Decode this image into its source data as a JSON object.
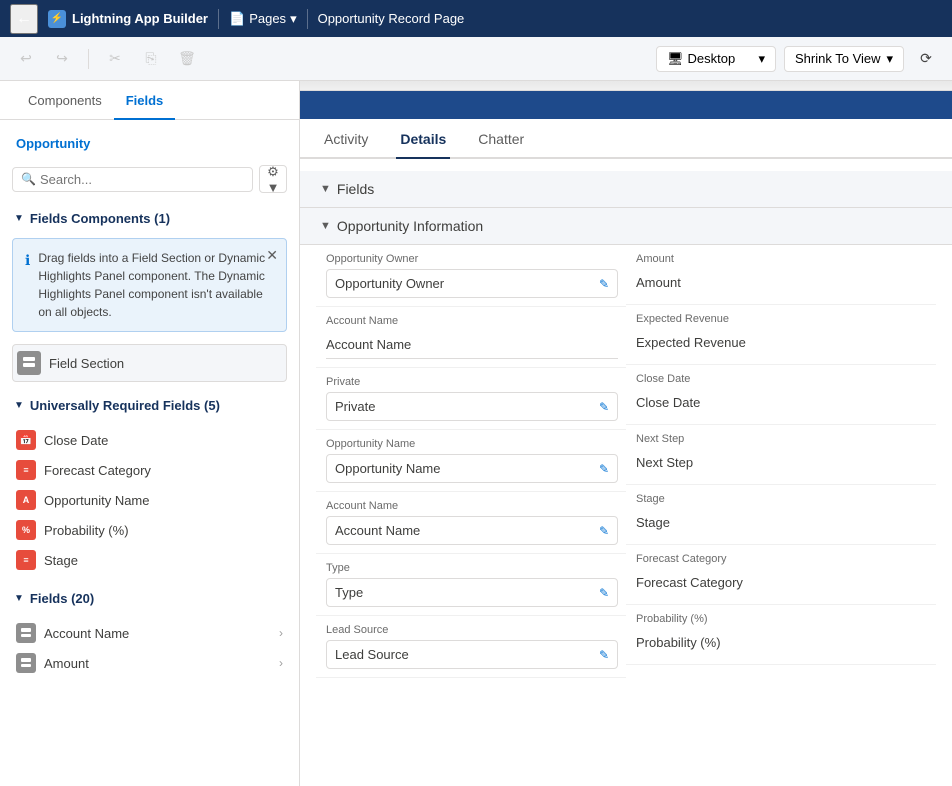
{
  "topNav": {
    "backLabel": "←",
    "appIcon": "⚡",
    "appName": "Lightning App Builder",
    "pagesLabel": "Pages",
    "pageTitle": "Opportunity Record Page"
  },
  "toolbar": {
    "undoLabel": "↩",
    "redoLabel": "↪",
    "cutLabel": "✂",
    "copyLabel": "⧉",
    "deleteLabel": "🗑",
    "desktopLabel": "Desktop",
    "shrinkLabel": "Shrink To View"
  },
  "sidebar": {
    "tab1": "Components",
    "tab2": "Fields",
    "sectionTitle": "Opportunity",
    "searchPlaceholder": "Search...",
    "fieldsComponents": {
      "header": "Fields Components (1)",
      "infoText": "Drag fields into a Field Section or Dynamic Highlights Panel component. The Dynamic Highlights Panel component isn't available on all objects.",
      "item": "Field Section"
    },
    "universallyRequired": {
      "header": "Universally Required Fields (5)",
      "items": [
        {
          "label": "Close Date",
          "type": "date"
        },
        {
          "label": "Forecast Category",
          "type": "list"
        },
        {
          "label": "Opportunity Name",
          "type": "text"
        },
        {
          "label": "Probability (%)",
          "type": "num"
        },
        {
          "label": "Stage",
          "type": "stage"
        }
      ]
    },
    "fields": {
      "header": "Fields (20)",
      "items": [
        {
          "label": "Account Name"
        },
        {
          "label": "Amount"
        }
      ]
    }
  },
  "content": {
    "tabs": [
      {
        "label": "Activity"
      },
      {
        "label": "Details",
        "active": true
      },
      {
        "label": "Chatter"
      }
    ],
    "fieldsSection": "Fields",
    "oppInfo": "Opportunity Information",
    "leftFields": [
      {
        "label": "Opportunity Owner",
        "value": "Opportunity Owner",
        "editable": true
      },
      {
        "label": "Account Name",
        "value": "Account Name",
        "editable": false
      },
      {
        "label": "Private",
        "value": "Private",
        "editable": true
      },
      {
        "label": "Opportunity Name",
        "value": "Opportunity Name",
        "editable": true
      },
      {
        "label": "Account Name",
        "value": "Account Name",
        "editable": true
      },
      {
        "label": "Type",
        "value": "Type",
        "editable": true
      },
      {
        "label": "Lead Source",
        "value": "Lead Source",
        "editable": true
      }
    ],
    "rightFields": [
      {
        "label": "Amount",
        "value": "Amount",
        "editable": false
      },
      {
        "label": "Expected Revenue",
        "value": "Expected Revenue",
        "editable": false
      },
      {
        "label": "Close Date",
        "value": "Close Date",
        "editable": false
      },
      {
        "label": "Next Step",
        "value": "Next Step",
        "editable": false
      },
      {
        "label": "Stage",
        "value": "Stage",
        "editable": false
      },
      {
        "label": "Forecast Category",
        "value": "Forecast Category",
        "editable": false
      },
      {
        "label": "Probability (%)",
        "value": "Probability (%)",
        "editable": false
      }
    ]
  }
}
